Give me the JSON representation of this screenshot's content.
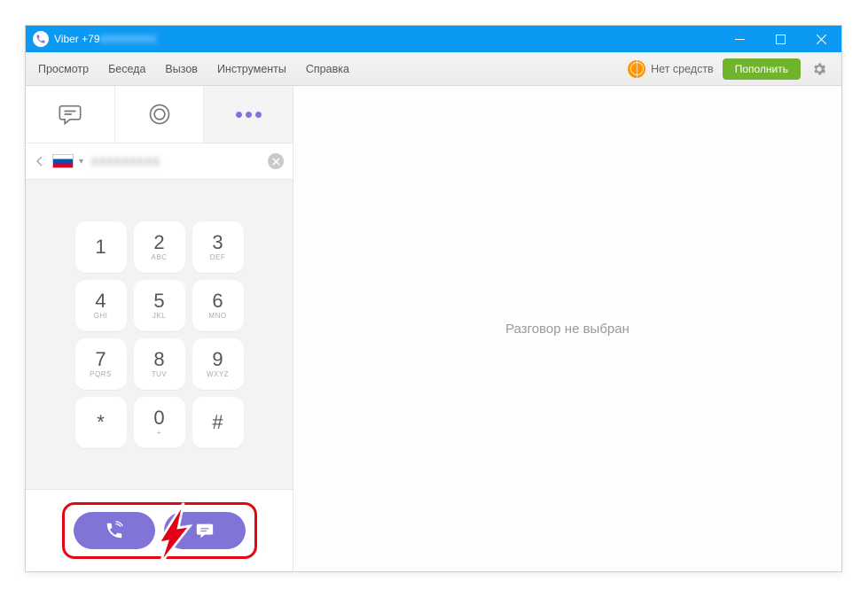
{
  "titlebar": {
    "app_name": "Viber",
    "phone_prefix": "+79",
    "phone_blurred": "XXXXXXXX"
  },
  "menubar": {
    "items": [
      "Просмотр",
      "Беседа",
      "Вызов",
      "Инструменты",
      "Справка"
    ],
    "balance_label": "Нет средств",
    "topup_label": "Пополнить"
  },
  "number_row": {
    "country": "RU",
    "value": "XXXXXXXXX"
  },
  "dialpad": {
    "keys": [
      {
        "num": "1",
        "sub": ""
      },
      {
        "num": "2",
        "sub": "ABC"
      },
      {
        "num": "3",
        "sub": "DEF"
      },
      {
        "num": "4",
        "sub": "GHI"
      },
      {
        "num": "5",
        "sub": "JKL"
      },
      {
        "num": "6",
        "sub": "MNO"
      },
      {
        "num": "7",
        "sub": "PQRS"
      },
      {
        "num": "8",
        "sub": "TUV"
      },
      {
        "num": "9",
        "sub": "WXYZ"
      },
      {
        "num": "*",
        "sub": ""
      },
      {
        "num": "0",
        "sub": "+"
      },
      {
        "num": "#",
        "sub": ""
      }
    ]
  },
  "main": {
    "empty_state": "Разговор не выбран"
  },
  "colors": {
    "accent_blue": "#0C99F2",
    "accent_purple": "#8074D6",
    "topup_green": "#6FB42C",
    "highlight_red": "#E30613",
    "balance_orange": "#FF9500"
  }
}
